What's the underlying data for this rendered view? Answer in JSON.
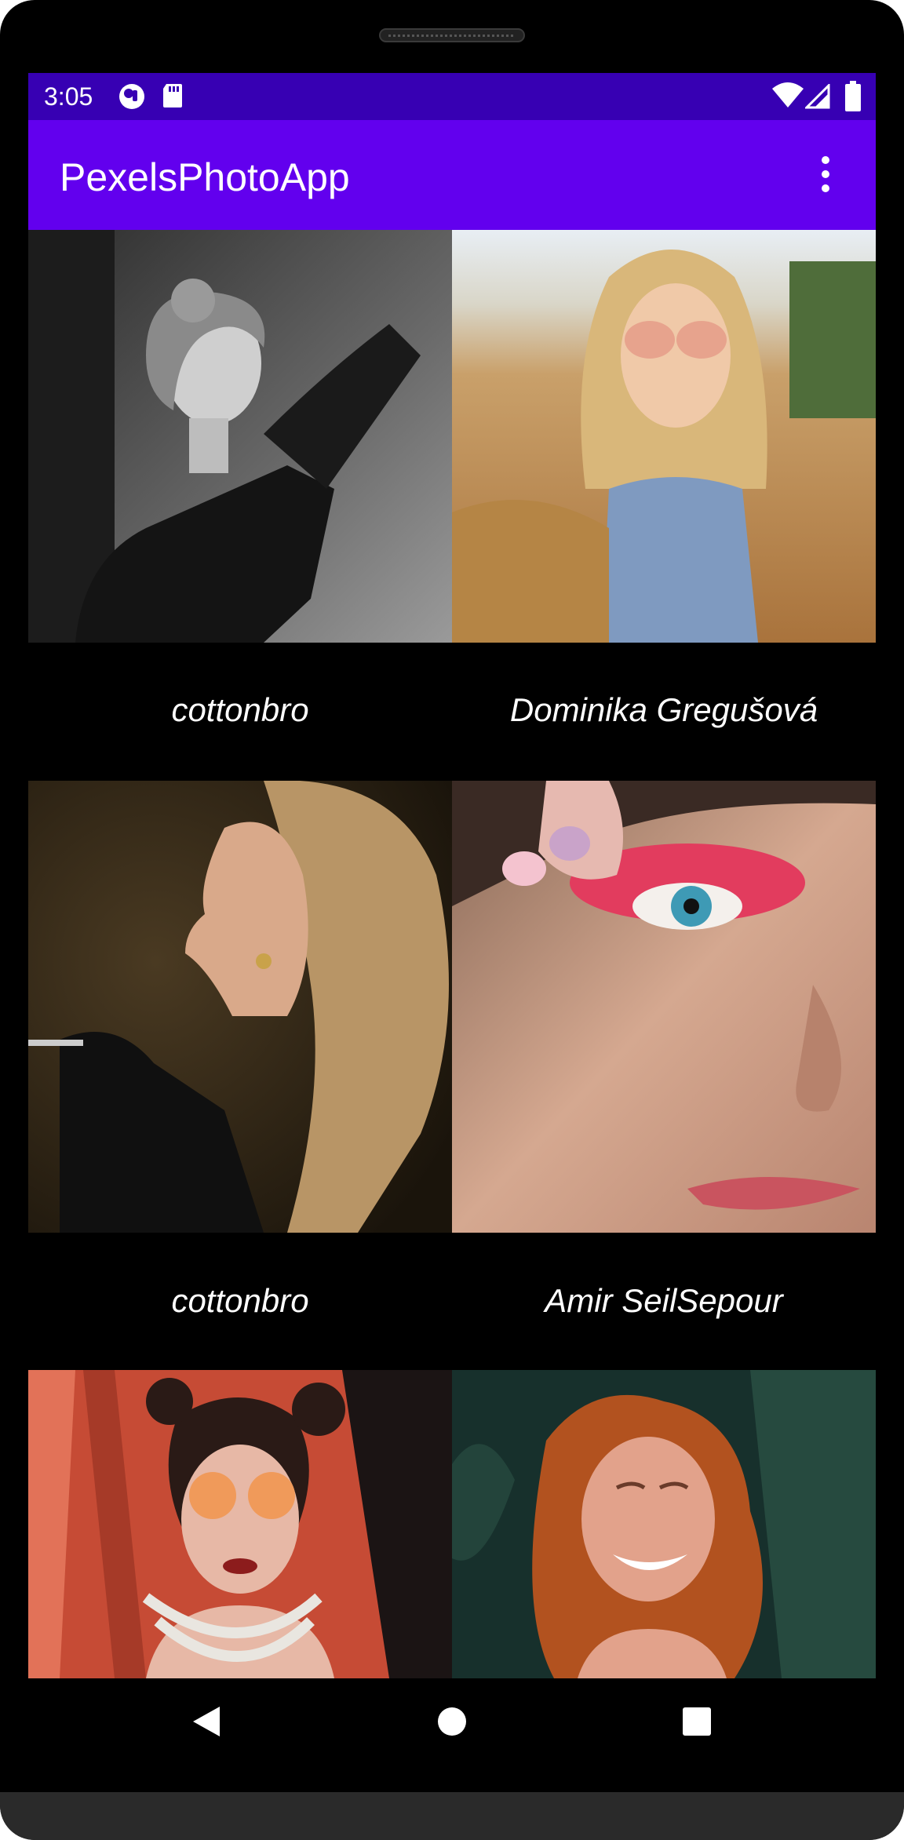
{
  "status_bar": {
    "time": "3:05",
    "left_icons": [
      "app-notification-icon",
      "sd-card-icon"
    ],
    "right_icons": [
      "wifi-icon",
      "cell-signal-icon",
      "battery-icon"
    ],
    "background_color": "#3700B3"
  },
  "app_bar": {
    "title": "PexelsPhotoApp",
    "background_color": "#6200EE",
    "menu_icon": "overflow-menu-icon"
  },
  "photos": [
    {
      "photographer": "cottonbro"
    },
    {
      "photographer": "Dominika Gregušová"
    },
    {
      "photographer": "cottonbro"
    },
    {
      "photographer": "Amir SeilSepour"
    },
    {
      "photographer": ""
    },
    {
      "photographer": ""
    }
  ],
  "nav_bar": {
    "buttons": [
      "back-icon",
      "home-icon",
      "recents-icon"
    ]
  }
}
